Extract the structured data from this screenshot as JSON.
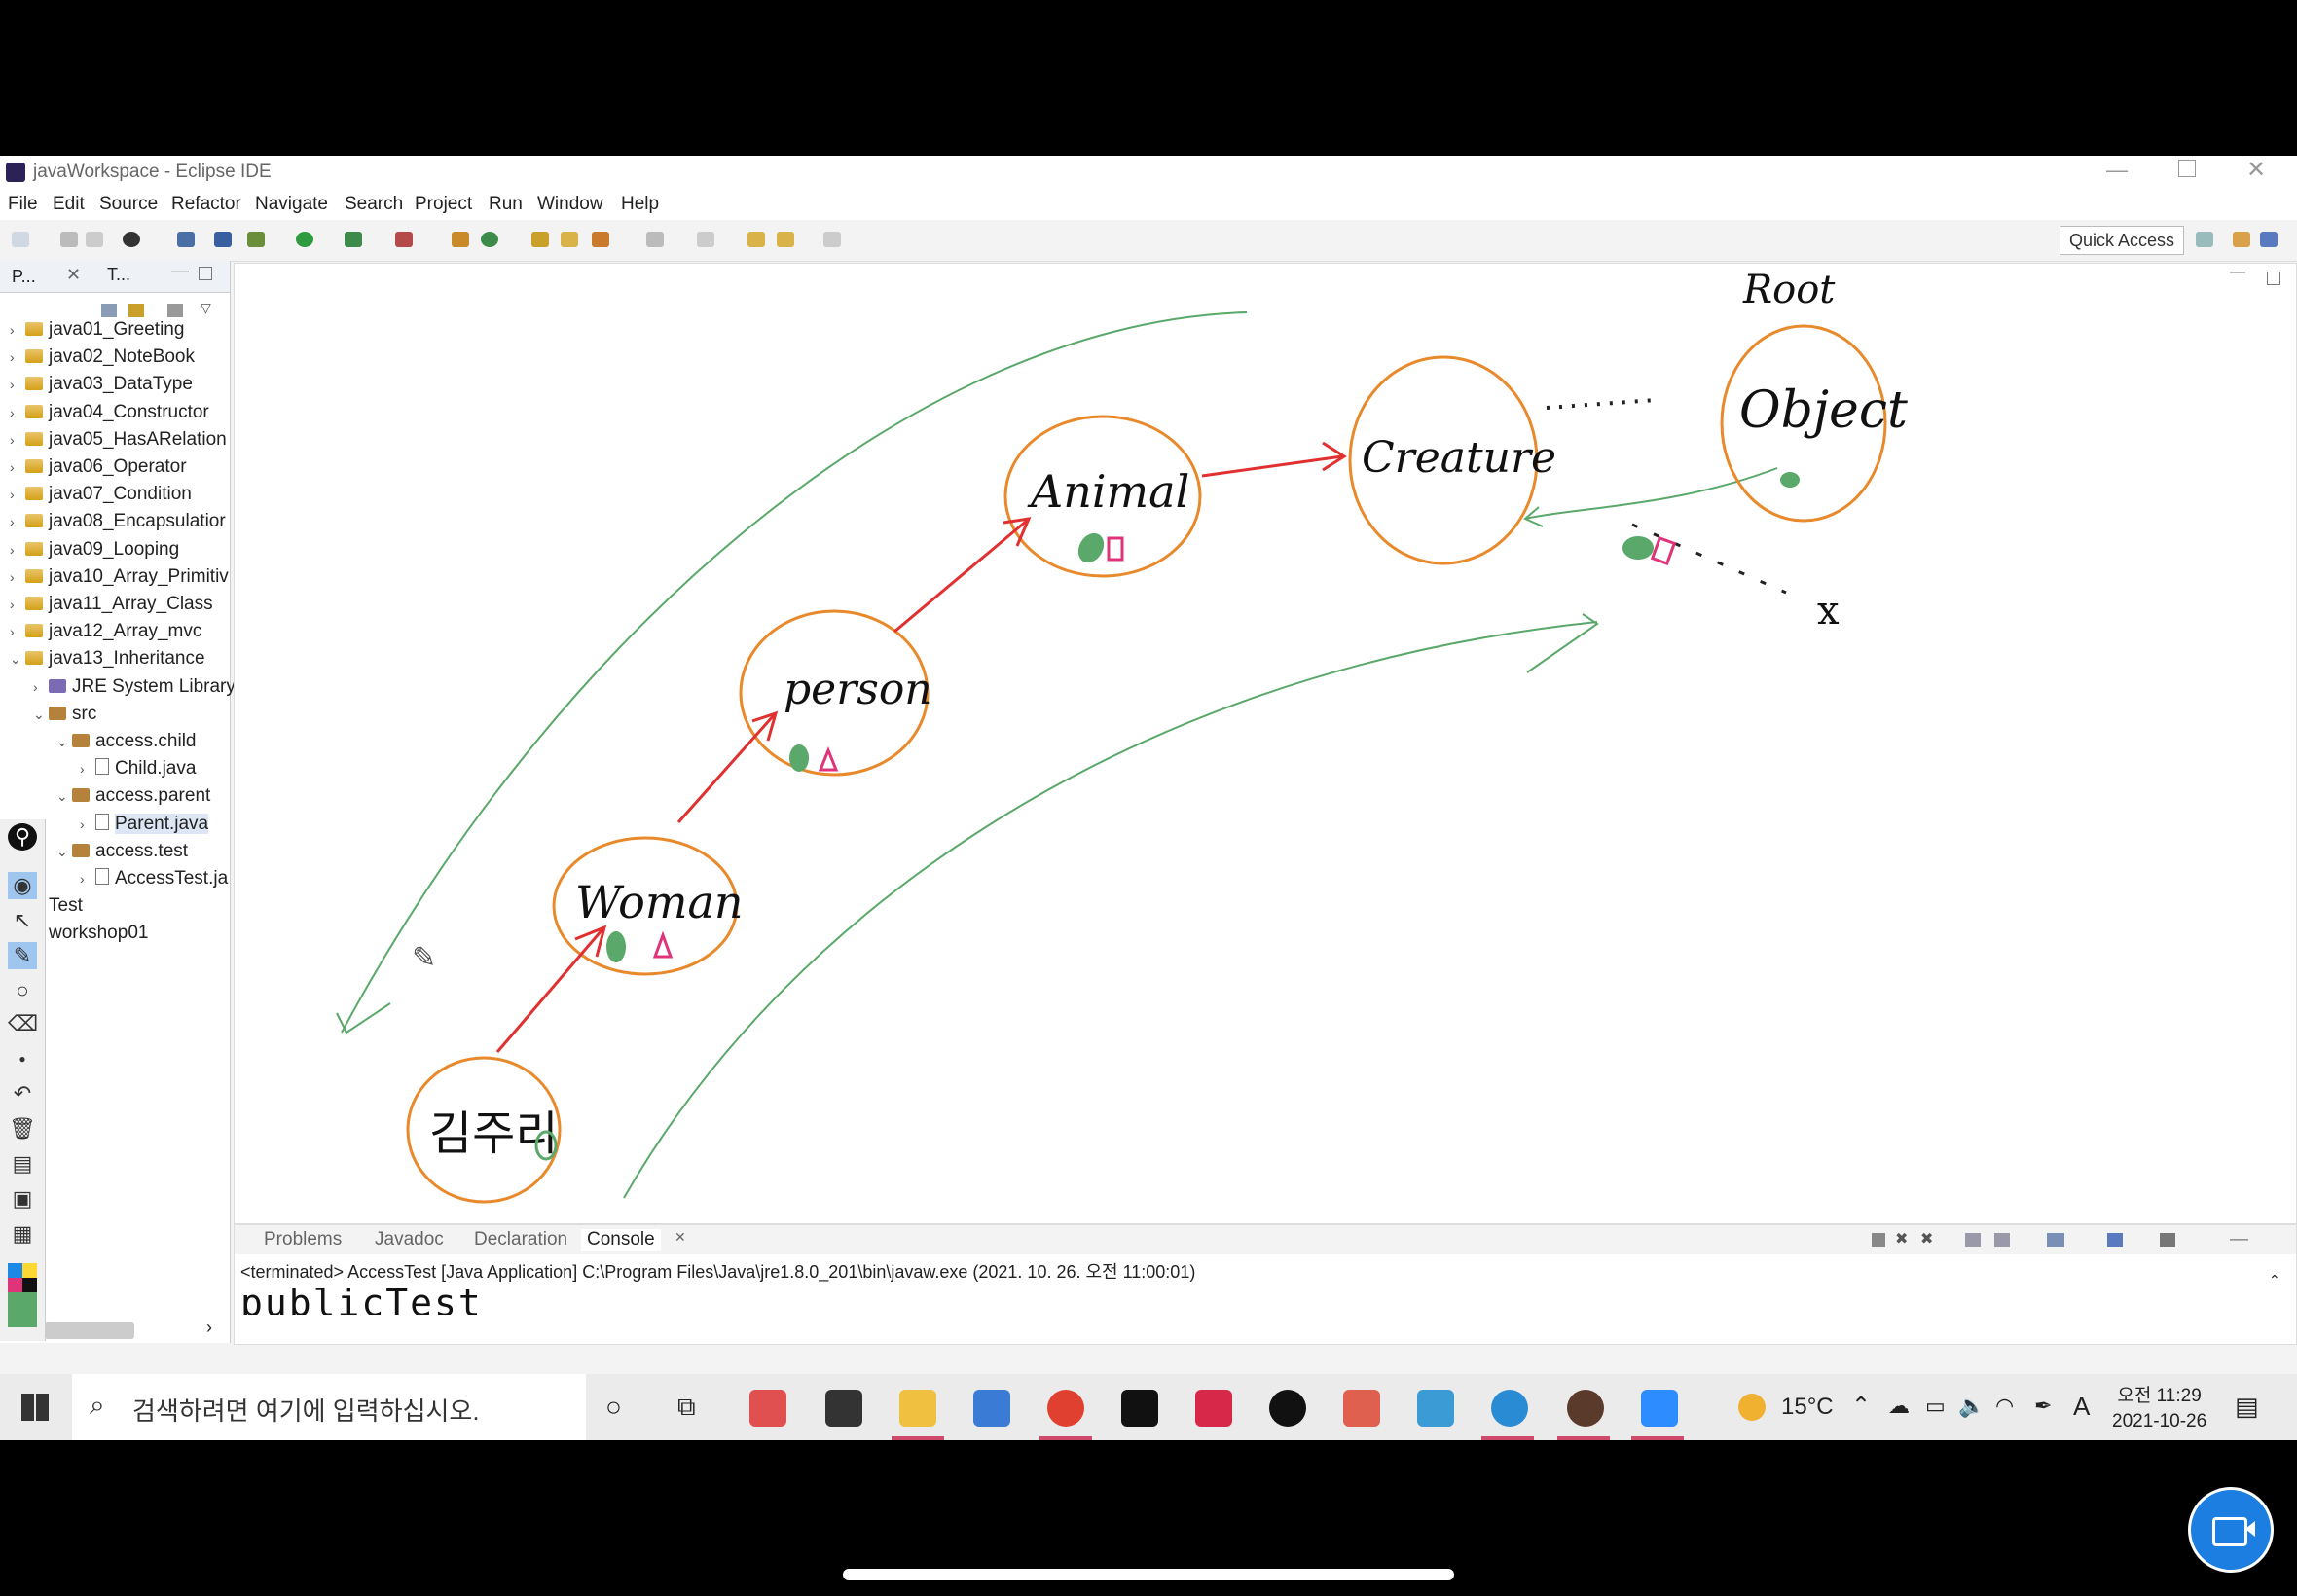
{
  "window": {
    "title": "javaWorkspace - Eclipse IDE"
  },
  "menu": [
    "File",
    "Edit",
    "Source",
    "Refactor",
    "Navigate",
    "Search",
    "Project",
    "Run",
    "Window",
    "Help"
  ],
  "toolbar": {
    "quick_access": "Quick Access"
  },
  "left_panel": {
    "tabs": [
      "P...",
      "T..."
    ],
    "tree": [
      {
        "label": "java01_Greeting",
        "indent": 0,
        "expanded": false,
        "type": "proj"
      },
      {
        "label": "java02_NoteBook",
        "indent": 0,
        "expanded": false,
        "type": "proj"
      },
      {
        "label": "java03_DataType",
        "indent": 0,
        "expanded": false,
        "type": "proj"
      },
      {
        "label": "java04_Constructor",
        "indent": 0,
        "expanded": false,
        "type": "proj"
      },
      {
        "label": "java05_HasARelation",
        "indent": 0,
        "expanded": false,
        "type": "proj"
      },
      {
        "label": "java06_Operator",
        "indent": 0,
        "expanded": false,
        "type": "proj"
      },
      {
        "label": "java07_Condition",
        "indent": 0,
        "expanded": false,
        "type": "proj"
      },
      {
        "label": "java08_Encapsulatior",
        "indent": 0,
        "expanded": false,
        "type": "proj"
      },
      {
        "label": "java09_Looping",
        "indent": 0,
        "expanded": false,
        "type": "proj"
      },
      {
        "label": "java10_Array_Primitiv",
        "indent": 0,
        "expanded": false,
        "type": "proj"
      },
      {
        "label": "java11_Array_Class",
        "indent": 0,
        "expanded": false,
        "type": "proj"
      },
      {
        "label": "java12_Array_mvc",
        "indent": 0,
        "expanded": false,
        "type": "proj"
      },
      {
        "label": "java13_Inheritance",
        "indent": 0,
        "expanded": true,
        "type": "proj"
      },
      {
        "label": "JRE System Library",
        "indent": 1,
        "expanded": false,
        "type": "lib"
      },
      {
        "label": "src",
        "indent": 1,
        "expanded": true,
        "type": "pkg"
      },
      {
        "label": "access.child",
        "indent": 2,
        "expanded": true,
        "type": "pkg"
      },
      {
        "label": "Child.java",
        "indent": 3,
        "expanded": false,
        "type": "java"
      },
      {
        "label": "access.parent",
        "indent": 2,
        "expanded": true,
        "type": "pkg"
      },
      {
        "label": "Parent.java",
        "indent": 3,
        "expanded": false,
        "type": "java",
        "selected": true
      },
      {
        "label": "access.test",
        "indent": 2,
        "expanded": true,
        "type": "pkg"
      },
      {
        "label": "AccessTest.ja",
        "indent": 3,
        "expanded": false,
        "type": "java"
      },
      {
        "label": "Test",
        "indent": 0,
        "expanded": false,
        "type": "proj"
      },
      {
        "label": "workshop01",
        "indent": 0,
        "expanded": false,
        "type": "proj"
      }
    ]
  },
  "drawing": {
    "root_label": "Root",
    "nodes": [
      "김주리",
      "Woman",
      "person",
      "Animal",
      "Creature",
      "Object"
    ],
    "x_mark": "x"
  },
  "bottom_panel": {
    "tabs": [
      "Problems",
      "Javadoc",
      "Declaration",
      "Console"
    ],
    "active_tab": "Console",
    "console_header": "<terminated> AccessTest [Java Application] C:\\Program Files\\Java\\jre1.8.0_201\\bin\\javaw.exe (2021. 10. 26. 오전 11:00:01)",
    "console_output": "publicTest"
  },
  "taskbar": {
    "search_placeholder": "검색하려면 여기에 입력하십시오.",
    "weather": "15°C",
    "time": "오전 11:29",
    "date": "2021-10-26"
  },
  "colors": {
    "accent": "#1c7ee0",
    "arrow_red": "#e03030",
    "circle_orange": "#e8892b",
    "green_stroke": "#5aa86a",
    "pink": "#e0347a"
  }
}
